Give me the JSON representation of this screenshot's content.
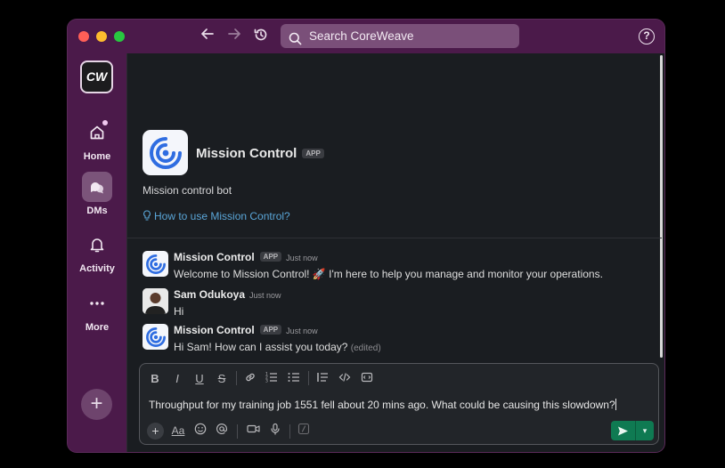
{
  "window": {
    "search_placeholder": "Search CoreWeave"
  },
  "sidebar": {
    "workspace_logo": "CW",
    "items": [
      {
        "label": "Home",
        "icon": "home-icon",
        "notification": true
      },
      {
        "label": "DMs",
        "icon": "dms-icon",
        "active": true
      },
      {
        "label": "Activity",
        "icon": "bell-icon"
      },
      {
        "label": "More",
        "icon": "more-icon"
      }
    ]
  },
  "intro": {
    "name": "Mission Control",
    "badge": "APP",
    "description": "Mission control bot",
    "link": "How to use Mission Control?"
  },
  "messages": [
    {
      "sender": "Mission Control",
      "badge": "APP",
      "time": "Just now",
      "text": "Welcome to Mission Control! 🚀 I'm here to help you manage and monitor your operations.",
      "edited": ""
    },
    {
      "sender": "Sam Odukoya",
      "badge": "",
      "time": "Just now",
      "text": "Hi",
      "edited": ""
    },
    {
      "sender": "Mission Control",
      "badge": "APP",
      "time": "Just now",
      "text": "Hi Sam! How can I assist you today?",
      "edited": "(edited)"
    }
  ],
  "composer": {
    "text": "Throughput for my training job 1551 fell about 20 mins ago. What could be causing this slowdown?",
    "toolbar": [
      "B",
      "I",
      "U",
      "S"
    ],
    "format_label": "Aa"
  },
  "colors": {
    "sidebar": "#4b1a4a",
    "main": "#1a1d21",
    "send": "#0f7a52",
    "link": "#5aa6d8"
  }
}
